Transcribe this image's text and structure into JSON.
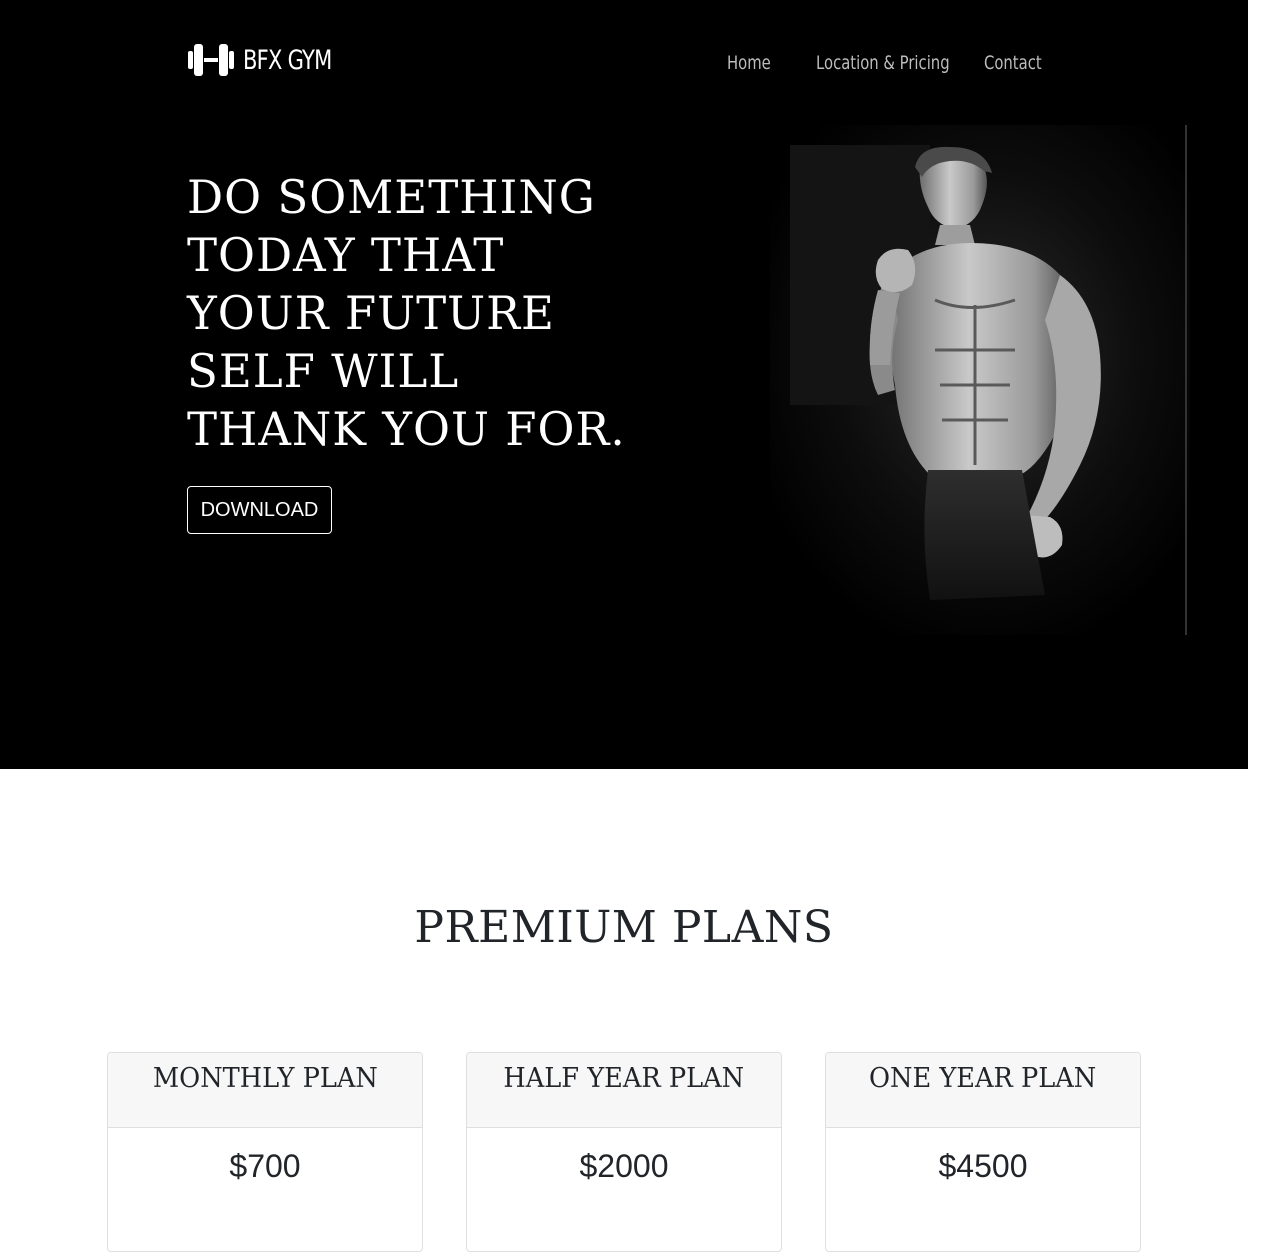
{
  "brand": {
    "name": "BFX GYM",
    "icon": "dumbbell-icon"
  },
  "nav": {
    "items": [
      {
        "label": "Home"
      },
      {
        "label": "Location & Pricing"
      },
      {
        "label": "Contact"
      }
    ]
  },
  "hero": {
    "headline": "DO SOMETHING TODAY THAT YOUR FUTURE SELF WILL THANK YOU FOR.",
    "download_label": "DOWNLOAD",
    "image": "bodybuilder-photo"
  },
  "plans": {
    "title": "PREMIUM PLANS",
    "items": [
      {
        "name": "MONTHLY PLAN",
        "price": "$700"
      },
      {
        "name": "HALF YEAR PLAN",
        "price": "$2000"
      },
      {
        "name": "ONE YEAR PLAN",
        "price": "$4500"
      }
    ]
  },
  "colors": {
    "hero_bg": "#000000",
    "text_dark": "#212529",
    "card_header_bg": "#f7f7f7"
  }
}
